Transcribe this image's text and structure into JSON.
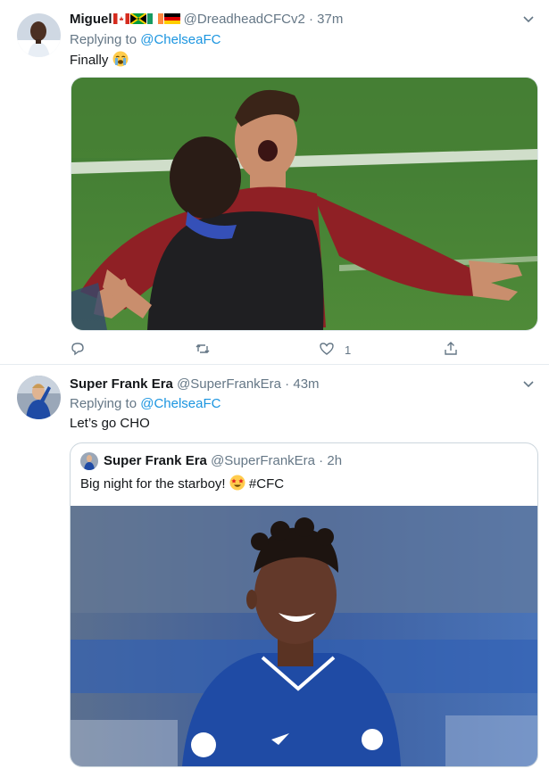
{
  "tweets": [
    {
      "name": "Miguel",
      "handle": "@DreadheadCFCv2",
      "sep": " · ",
      "time": "37m",
      "replying_prefix": "Replying to ",
      "replying_to": "@ChelseaFC",
      "text": "Finally ",
      "emoji": "crying-face",
      "media_icon": "celebration-photo",
      "actions": {
        "reply_count": "",
        "retweet_count": "",
        "like_count": "1"
      }
    },
    {
      "name": "Super Frank Era",
      "handle": "@SuperFrankEra",
      "sep": " · ",
      "time": "43m",
      "replying_prefix": "Replying to ",
      "replying_to": "@ChelseaFC",
      "text": "Let’s go CHO",
      "quote": {
        "name": "Super Frank Era",
        "handle": "@SuperFrankEra",
        "sep": " · ",
        "time": "2h",
        "text_before": "Big night for the starboy! ",
        "emoji": "star-struck",
        "text_after": " #CFC"
      }
    }
  ],
  "colors": {
    "link": "#1b95e0",
    "muted": "#657786",
    "border": "#e6ecf0",
    "chelsea_blue": "#1f4ba5"
  }
}
